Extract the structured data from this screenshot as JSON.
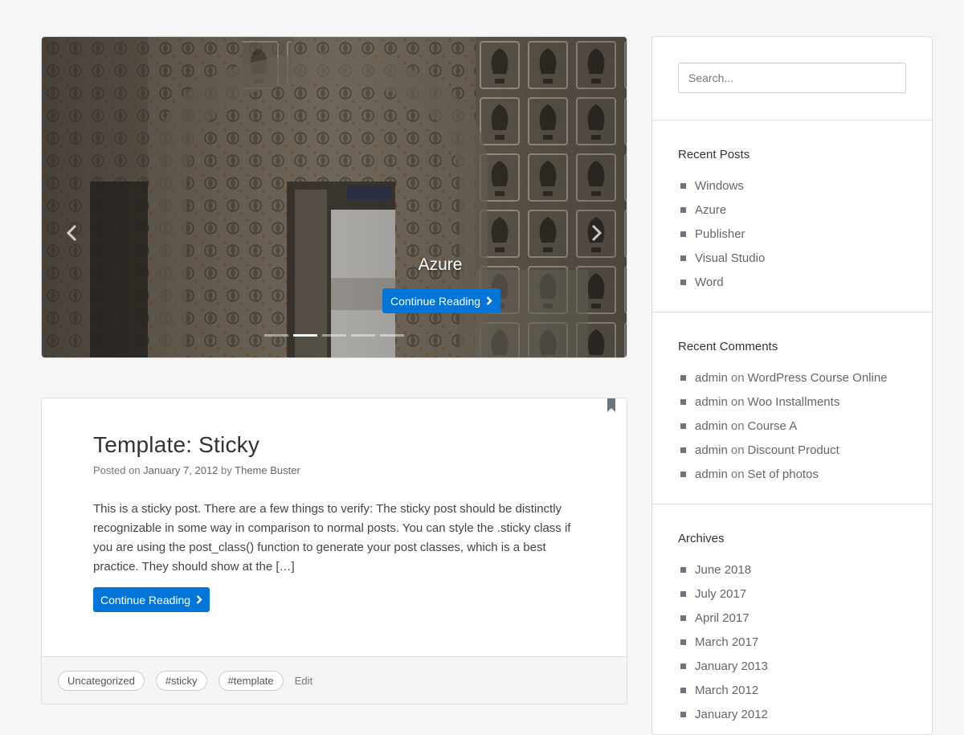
{
  "slider": {
    "slide_title": "Azure",
    "button_label": "Continue Reading",
    "dots": 5,
    "active_dot": 1,
    "prev_icon": "chevron-left-icon",
    "next_icon": "chevron-right-icon"
  },
  "post": {
    "title": "Template: Sticky",
    "meta_prefix": "Posted on",
    "date": "January 7, 2012",
    "meta_by": "by",
    "author": "Theme Buster",
    "excerpt": "This is a sticky post. There are a few things to verify: The sticky post should be distinctly recognizable in some way in comparison to normal posts. You can style the .sticky class if you are using the post_class() function to generate your post classes, which is a best practice. They should show at the […]",
    "button_label": "Continue Reading",
    "tags": [
      "Uncategorized",
      "#sticky",
      "#template"
    ],
    "edit_label": "Edit",
    "bookmark_icon": "bookmark-icon"
  },
  "sidebar": {
    "search": {
      "placeholder": "Search..."
    },
    "recent_posts": {
      "title": "Recent Posts",
      "items": [
        "Windows",
        "Azure",
        "Publisher",
        "Visual Studio",
        "Word"
      ]
    },
    "recent_comments": {
      "title": "Recent Comments",
      "items": [
        {
          "author": "admin",
          "on": "on",
          "post": "WordPress Course Online"
        },
        {
          "author": "admin",
          "on": "on",
          "post": "Woo Installments"
        },
        {
          "author": "admin",
          "on": "on",
          "post": "Course A"
        },
        {
          "author": "admin",
          "on": "on",
          "post": "Discount Product"
        },
        {
          "author": "admin",
          "on": "on",
          "post": "Set of photos"
        }
      ]
    },
    "archives": {
      "title": "Archives",
      "items": [
        "June 2018",
        "July 2017",
        "April 2017",
        "March 2017",
        "January 2013",
        "March 2012",
        "January 2012"
      ]
    }
  },
  "colors": {
    "primary": "#0275d8",
    "background": "#f5f6f8"
  }
}
